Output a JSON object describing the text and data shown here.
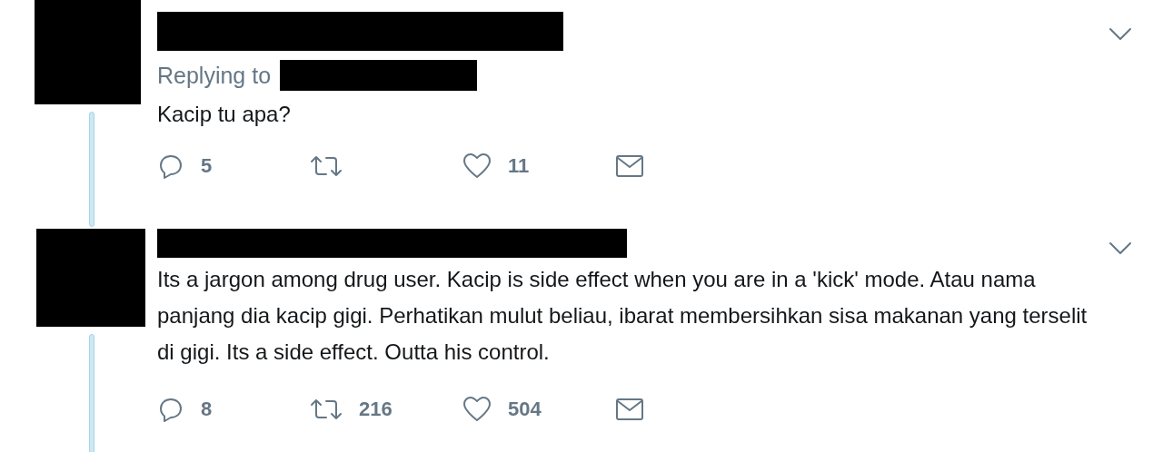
{
  "tweets": [
    {
      "replying_to": "Replying to",
      "text": "Kacip tu apa?",
      "actions": [
        {
          "kind": "reply",
          "count": "5"
        },
        {
          "kind": "retweet"
        },
        {
          "kind": "like",
          "count": "11"
        },
        {
          "kind": "message"
        }
      ]
    },
    {
      "text": "Its a jargon among drug user. Kacip is side effect when you are in a 'kick' mode. Atau nama panjang dia kacip gigi. Perhatikan mulut beliau, ibarat membersihkan sisa makanan yang terselit di gigi. Its a side effect. Outta his control.",
      "actions": [
        {
          "kind": "reply",
          "count": "8"
        },
        {
          "kind": "retweet",
          "count": "216"
        },
        {
          "kind": "like",
          "count": "504"
        },
        {
          "kind": "message"
        }
      ]
    }
  ]
}
